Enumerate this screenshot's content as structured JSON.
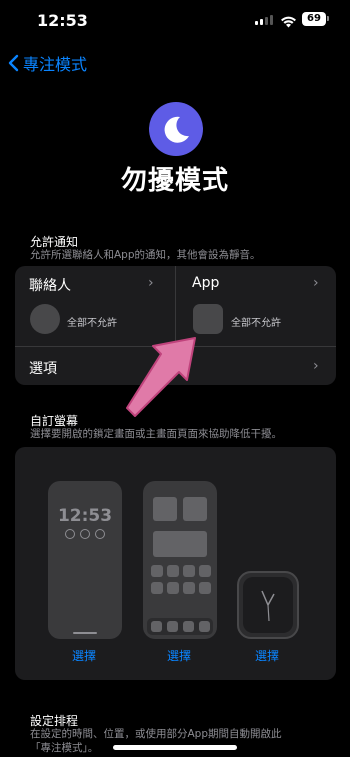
{
  "status": {
    "time": "12:53",
    "battery": "69"
  },
  "nav": {
    "back_label": "專注模式"
  },
  "header": {
    "title": "勿擾模式"
  },
  "allowed": {
    "title": "允許通知",
    "subtitle": "允許所選聯絡人和App的通知，其他會設為靜音。",
    "people": {
      "label": "聯絡人",
      "value": "全部不允許"
    },
    "apps": {
      "label": "App",
      "value": "全部不允許"
    },
    "options": {
      "label": "選項"
    }
  },
  "custom_screen": {
    "title": "自訂螢幕",
    "subtitle": "選擇要開啟的鎖定畫面或主畫面頁面來協助降低干擾。",
    "lock_time": "12:53",
    "choose_lock": "選擇",
    "choose_home": "選擇",
    "choose_watch": "選擇"
  },
  "schedule": {
    "title": "設定排程",
    "subtitle_line1": "在設定的時間、位置，或使用部分App期間自動開啟此",
    "subtitle_line2": "「專注模式」。"
  },
  "colors": {
    "accent": "#0a84ff",
    "moon_bg": "#5e5ce6",
    "arrow": "#e07aa8"
  },
  "icons": [
    "back-chevron-icon",
    "moon-icon",
    "chevron-right-icon",
    "arrow-icon"
  ]
}
